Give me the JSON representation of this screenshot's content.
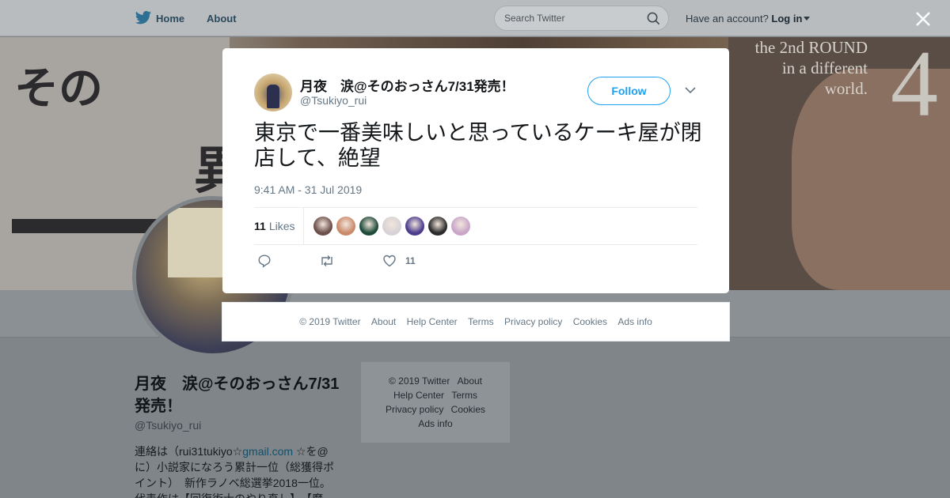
{
  "nav": {
    "home": "Home",
    "about": "About",
    "search_placeholder": "Search Twitter",
    "account_prompt": "Have an account?",
    "login": "Log in"
  },
  "banner": {
    "line1": "the 2nd ROUND",
    "line2": "in a different",
    "line3": "world.",
    "volume": "4",
    "kana1": "その",
    "kana2": "異"
  },
  "profile": {
    "name": "月夜　涙@そのおっさん7/31発売！",
    "handle": "@Tsukiyo_rui",
    "bio_prefix": "連絡は（rui31tukiyo☆",
    "bio_link": "gmail.com",
    "bio_rest": " ☆を@に）小説家になろう累計一位（総獲得ポイント）　新作ラノベ総選挙2018一位。代表作は【回復術士のやり直し】　【魔"
  },
  "sidebar_links": [
    "© 2019 Twitter",
    "About",
    "Help Center",
    "Terms",
    "Privacy policy",
    "Cookies",
    "Ads info"
  ],
  "tweet": {
    "name": "月夜　涙@そのおっさん7/31発売！",
    "handle": "@Tsukiyo_rui",
    "follow_label": "Follow",
    "text": "東京で一番美味しいと思っているケーキ屋が閉店して、絶望",
    "timestamp": "9:41 AM - 31 Jul 2019",
    "likes_count": "11",
    "likes_label": "Likes",
    "like_action_count": "11",
    "liker_colors": [
      "#6b4f4a",
      "#c98a6a",
      "#1e4a3a",
      "#d8d2d6",
      "#4b3c8c",
      "#2a2a2a",
      "#c9a6c9"
    ]
  },
  "footer": {
    "copyright": "© 2019 Twitter",
    "about": "About",
    "help": "Help Center",
    "terms": "Terms",
    "privacy": "Privacy policy",
    "cookies": "Cookies",
    "ads": "Ads info"
  },
  "colors": {
    "accent": "#1da1f2",
    "overlay": "#7f8588"
  }
}
